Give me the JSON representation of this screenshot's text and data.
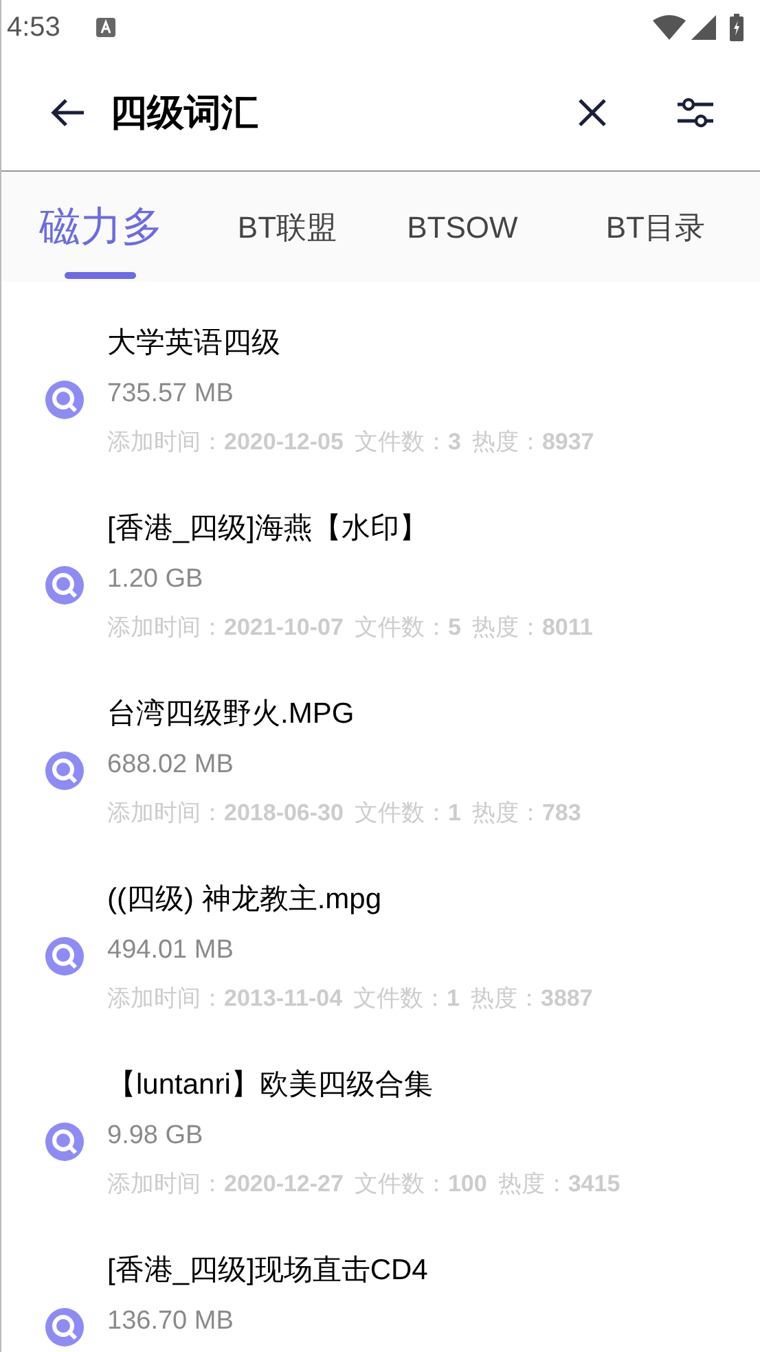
{
  "status_bar": {
    "time": "4:53"
  },
  "toolbar": {
    "query": "四级词汇"
  },
  "tabs": [
    {
      "label": "磁力多",
      "selected": true
    },
    {
      "label": "BT联盟",
      "selected": false
    },
    {
      "label": "BTSOW",
      "selected": false
    },
    {
      "label": "BT目录",
      "selected": false
    }
  ],
  "results": [
    {
      "title": "大学英语四级",
      "size": "735.57 MB",
      "meta": [
        {
          "label": "添加时间：",
          "value": "2020-12-05"
        },
        {
          "label": "文件数：",
          "value": "3"
        },
        {
          "label": "热度：",
          "value": "8937"
        }
      ]
    },
    {
      "title": "[香港_四级]海燕【水印】",
      "size": "1.20 GB",
      "meta": [
        {
          "label": "添加时间：",
          "value": "2021-10-07"
        },
        {
          "label": "文件数：",
          "value": "5"
        },
        {
          "label": "热度：",
          "value": "8011"
        }
      ]
    },
    {
      "title": "台湾四级野火.MPG",
      "size": "688.02 MB",
      "meta": [
        {
          "label": "添加时间：",
          "value": "2018-06-30"
        },
        {
          "label": "文件数：",
          "value": "1"
        },
        {
          "label": "热度：",
          "value": "783"
        }
      ]
    },
    {
      "title": "((四级) 神龙教主.mpg",
      "size": "494.01 MB",
      "meta": [
        {
          "label": "添加时间：",
          "value": "2013-11-04"
        },
        {
          "label": "文件数：",
          "value": "1"
        },
        {
          "label": "热度：",
          "value": "3887"
        }
      ]
    },
    {
      "title": "【luntanri】欧美四级合集",
      "size": "9.98 GB",
      "meta": [
        {
          "label": "添加时间：",
          "value": "2020-12-27"
        },
        {
          "label": "文件数：",
          "value": "100"
        },
        {
          "label": "热度：",
          "value": "3415"
        }
      ]
    },
    {
      "title": "[香港_四级]现场直击CD4",
      "size": "136.70 MB"
    }
  ]
}
